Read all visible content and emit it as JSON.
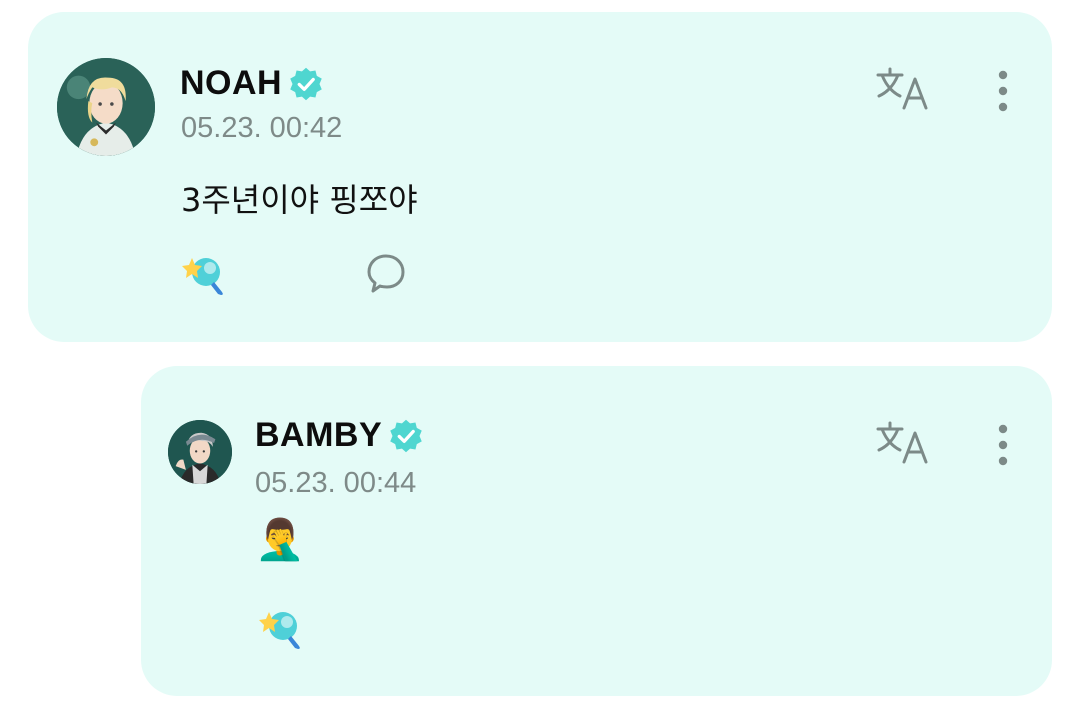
{
  "post": {
    "author": "NOAH",
    "time": "05.23. 00:42",
    "message": "3주년이야 핑쪼야",
    "cheer_count": "",
    "comment_count": "",
    "icons": {
      "verified": "verified-badge-icon",
      "translate": "translate-icon",
      "more": "more-vertical-icon",
      "cheer": "cheer-lightstick-icon",
      "comment": "comment-bubble-icon"
    }
  },
  "reply": {
    "author": "BAMBY",
    "time": "05.23. 00:44",
    "message": "🤦‍♂️",
    "cheer_count": "",
    "icons": {
      "verified": "verified-badge-icon",
      "translate": "translate-icon",
      "more": "more-vertical-icon",
      "cheer": "cheer-lightstick-icon"
    }
  },
  "colors": {
    "card_background": "#e4fbf7",
    "verified": "#4fd6d0",
    "icon_gray": "#7c8a88",
    "timestamp": "#7e8a88"
  }
}
